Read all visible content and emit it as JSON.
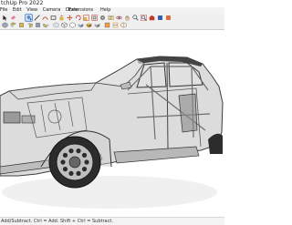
{
  "window": {
    "title": "tchUp Pro 2022"
  },
  "menu": {
    "items": [
      "File",
      "Edit",
      "View",
      "Camera",
      "Draw"
    ],
    "extensions": "Extensions",
    "help": "Help"
  },
  "toolbar": {
    "row1": [
      "select-tool",
      "eraser-tool",
      "paint-bucket-tool",
      "line-tool",
      "arc-tool",
      "rectangle-tool",
      "push-pull-tool",
      "move-tool",
      "rotate-tool",
      "scale-tool",
      "offset-tool",
      "tape-measure-tool",
      "text-tool",
      "orbit-tool",
      "pan-tool",
      "zoom-tool",
      "zoom-extents-tool",
      "3d-warehouse",
      "extension-warehouse",
      "layout",
      "styles"
    ],
    "row2": [
      "iso-view",
      "top-view",
      "front-view",
      "right-view",
      "back-view",
      "left-view",
      "xray-style",
      "wireframe-style",
      "hidden-line-style",
      "shaded-style",
      "textured-style",
      "monochrome-style",
      "section-plane",
      "section-display",
      "section-cuts"
    ],
    "selected_index": 2
  },
  "status": {
    "text": "Add/Subtract. Ctrl = Add. Shift + Ctrl = Subtract."
  },
  "scene": {
    "subject": "3d-car-model-xray",
    "body_color": "#c4c4c4",
    "edge_color": "#3a3a3a",
    "shadow_color": "#e9e9e9"
  }
}
